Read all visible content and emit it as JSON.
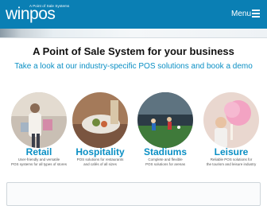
{
  "header": {
    "logo_word": "winpos",
    "logo_tagline": "A Point of Sale Systems",
    "menu_label": "Menu",
    "menu_icon": "hamburger-icon"
  },
  "main": {
    "headline": "A Point of Sale System for your business",
    "subhead": "Take a look at our industry-specific POS solutions and book a demo"
  },
  "categories": [
    {
      "title": "Retail",
      "desc": "User-friendly and versatile\nPOS systems for all types of stores"
    },
    {
      "title": "Hospitality",
      "desc": "POS solutions for restaurants\nand cafés of all sizes"
    },
    {
      "title": "Stadiums",
      "desc": "Complete and flexible\nPOS solutions for arenas"
    },
    {
      "title": "Leisure",
      "desc": "Reliable POS solutions for\nthe tourism and leisure industry"
    }
  ],
  "colors": {
    "brand": "#0a7fb4",
    "accent": "#0a8fc4"
  }
}
